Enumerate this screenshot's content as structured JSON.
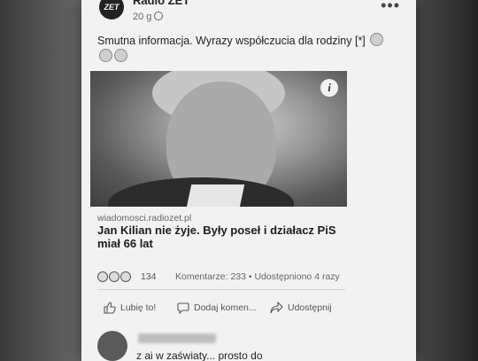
{
  "header": {
    "avatar_text": "ZET",
    "page_name": "Radio ZET",
    "time": "20 g"
  },
  "post": {
    "text": "Smutna informacja. Wyrazy współczucia dla rodziny [*]"
  },
  "link": {
    "domain": "wiadomosci.radiozet.pl",
    "title": "Jan Kilian nie żyje. Były poseł i działacz PiS miał 66 lat"
  },
  "engagement": {
    "reaction_count": "134",
    "comments_shares": "Komentarze: 233 • Udostępniono 4 razy"
  },
  "actions": {
    "like": "Lubię to!",
    "comment": "Dodaj komen...",
    "share": "Udostępnij"
  },
  "comment": {
    "text": "z          ai w zaświaty... prosto do"
  }
}
